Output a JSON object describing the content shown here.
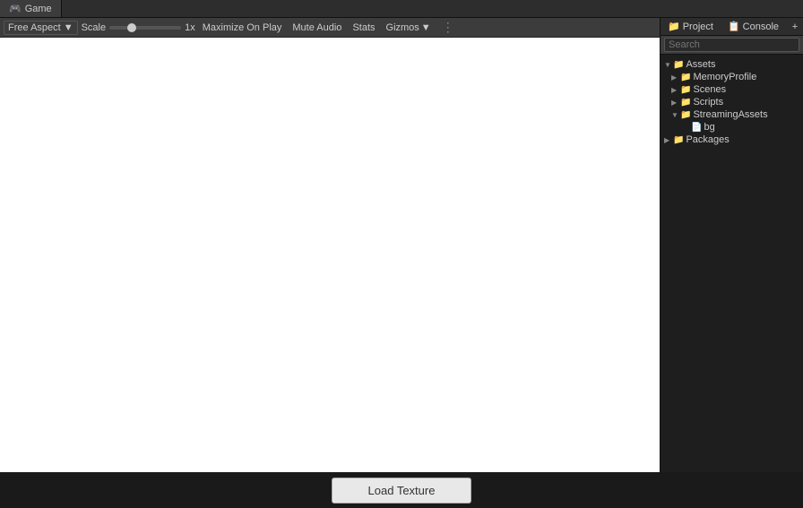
{
  "tabs": {
    "game": {
      "label": "Game",
      "icon": "🎮"
    }
  },
  "game_toolbar": {
    "free_aspect_label": "Free Aspect",
    "scale_label": "Scale",
    "scale_value": "1x",
    "maximize_label": "Maximize On Play",
    "mute_label": "Mute Audio",
    "stats_label": "Stats",
    "gizmos_label": "Gizmos"
  },
  "load_button": {
    "label": "Load Texture"
  },
  "right_panel": {
    "project_tab": "Project",
    "console_tab": "Console",
    "search_placeholder": "Search"
  },
  "file_tree": {
    "assets_root": "Assets",
    "items": [
      {
        "id": "assets",
        "label": "Assets",
        "type": "folder",
        "indent": 0,
        "expanded": true
      },
      {
        "id": "memory-profile",
        "label": "MemoryProfile",
        "type": "folder",
        "indent": 1,
        "expanded": false
      },
      {
        "id": "scenes",
        "label": "Scenes",
        "type": "folder",
        "indent": 1,
        "expanded": false
      },
      {
        "id": "scripts",
        "label": "Scripts",
        "type": "folder",
        "indent": 1,
        "expanded": false
      },
      {
        "id": "streaming-assets",
        "label": "StreamingAssets",
        "type": "folder",
        "indent": 1,
        "expanded": true
      },
      {
        "id": "bg",
        "label": "bg",
        "type": "file",
        "indent": 2,
        "expanded": false
      },
      {
        "id": "packages",
        "label": "Packages",
        "type": "folder",
        "indent": 0,
        "expanded": false
      }
    ]
  }
}
